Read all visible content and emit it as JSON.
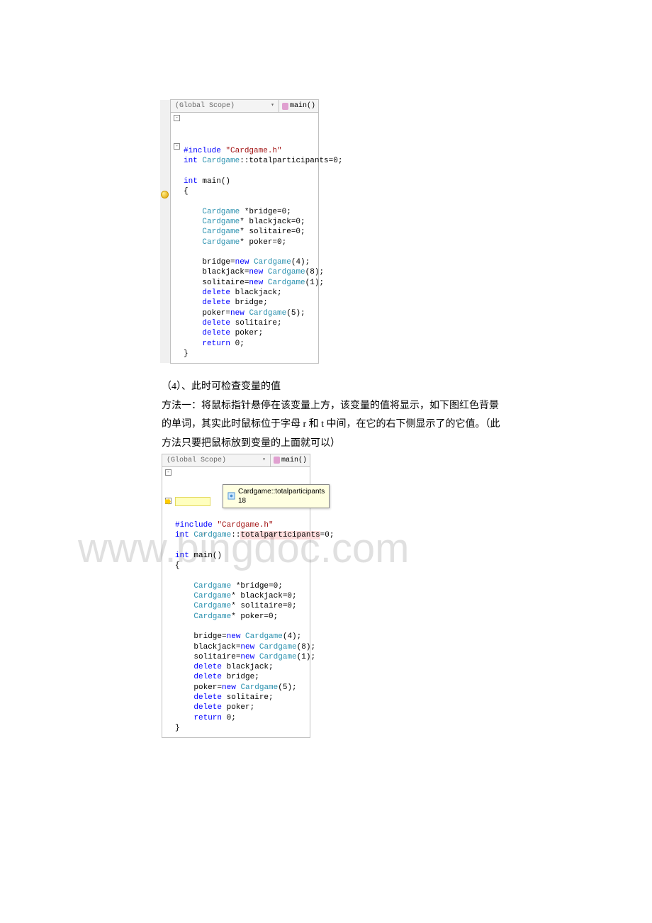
{
  "watermark": "www.bingdoc.com",
  "block1": {
    "scope_left": "(Global Scope)",
    "scope_right": "main()",
    "code": "#include \"Cardgame.h\"\nint Cardgame::totalparticipants=0;\n\nint main()\n{\n\n    Cardgame *bridge=0;\n    Cardgame* blackjack=0;\n    Cardgame* solitaire=0;\n    Cardgame* poker=0;\n\n    bridge=new Cardgame(4);\n    blackjack=new Cardgame(8);\n    solitaire=new Cardgame(1);\n    delete blackjack;\n    delete bridge;\n    poker=new Cardgame(5);\n    delete solitaire;\n    delete poker;\n    return 0;\n}"
  },
  "doctext": {
    "line1": "（4）、此时可检查变量的值",
    "line2": "方法一：将鼠标指针悬停在该变量上方，该变量的值将显示，如下图红色背景",
    "line3": "的单词，其实此时鼠标位于字母 r 和 t 中间，在它的右下侧显示了的它值。（此",
    "line4": "方法只要把鼠标放到变量的上面就可以）"
  },
  "block2": {
    "scope_left": "(Global Scope)",
    "scope_right": "main()",
    "tooltip": "Cardgame::totalparticipants 18",
    "code": "#include \"Cardgame.h\"\nint Cardgame::totalparticipants=0;\n\nint main()\n{\n\n    Cardgame *bridge=0;\n    Cardgame* blackjack=0;\n    Cardgame* solitaire=0;\n    Cardgame* poker=0;\n\n    bridge=new Cardgame(4);\n    blackjack=new Cardgame(8);\n    solitaire=new Cardgame(1);\n    delete blackjack;\n    delete bridge;\n    poker=new Cardgame(5);\n    delete solitaire;\n    delete poker;\n    return 0;\n}"
  }
}
